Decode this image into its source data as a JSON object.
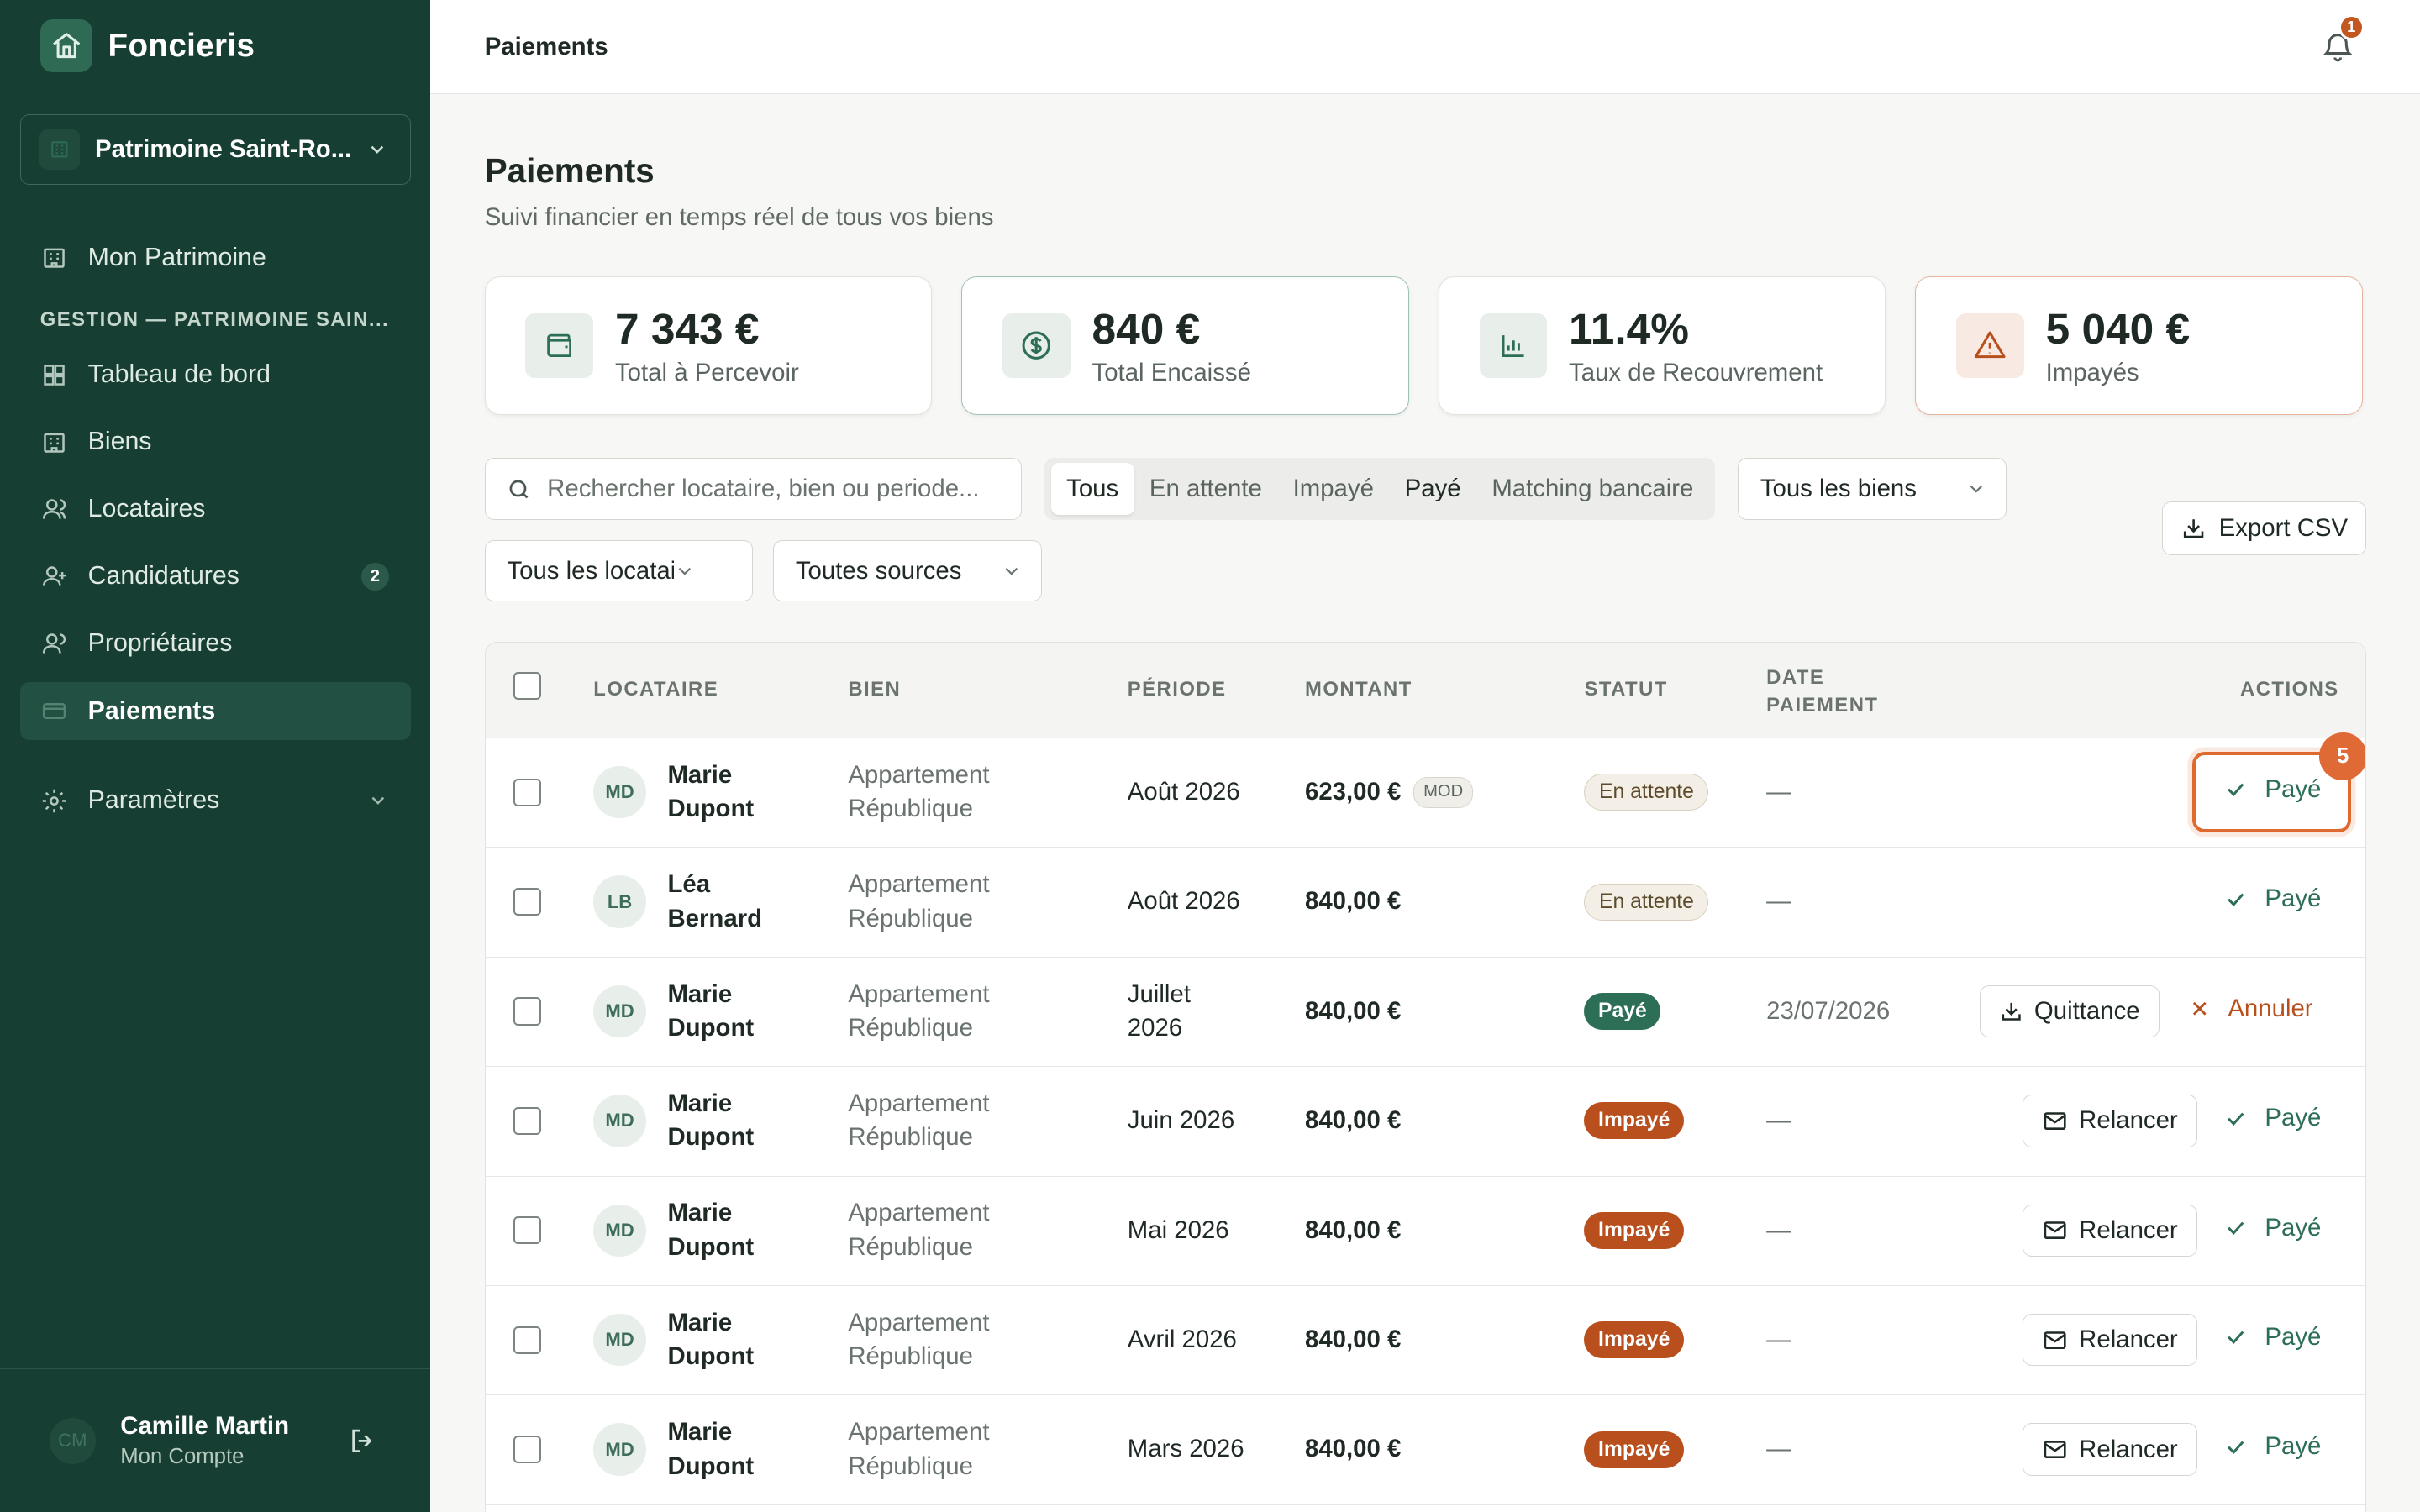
{
  "brand": {
    "name": "Foncieris"
  },
  "workspace": {
    "name": "Patrimoine Saint-Ro..."
  },
  "sidebar": {
    "top_item": "Mon Patrimoine",
    "section_label": "GESTION — PATRIMOINE SAIN...",
    "items": [
      {
        "label": "Tableau de bord",
        "icon": "dashboard-icon"
      },
      {
        "label": "Biens",
        "icon": "building-icon"
      },
      {
        "label": "Locataires",
        "icon": "user-icon"
      },
      {
        "label": "Candidatures",
        "icon": "user-plus-icon",
        "badge": "2"
      },
      {
        "label": "Propriétaires",
        "icon": "user-icon"
      },
      {
        "label": "Paiements",
        "icon": "credit-card-icon",
        "active": true
      }
    ],
    "settings": "Paramètres",
    "user": {
      "initials": "CM",
      "name": "Camille Martin",
      "sub": "Mon Compte"
    }
  },
  "topbar": {
    "title": "Paiements",
    "notifications": "1"
  },
  "page": {
    "title": "Paiements",
    "subtitle": "Suivi financier en temps réel de tous vos biens"
  },
  "stats": [
    {
      "value": "7 343 €",
      "label": "Total à Percevoir",
      "icon": "wallet-icon"
    },
    {
      "value": "840 €",
      "label": "Total Encaissé",
      "icon": "dollar-circle-icon"
    },
    {
      "value": "11.4%",
      "label": "Taux de Recouvrement",
      "icon": "bar-chart-icon"
    },
    {
      "value": "5 040 €",
      "label": "Impayés",
      "icon": "warning-icon"
    }
  ],
  "search": {
    "placeholder": "Rechercher locataire, bien ou periode...",
    "value": ""
  },
  "filters": [
    "Tous",
    "En attente",
    "Impayé",
    "Payé",
    "Matching bancaire"
  ],
  "selects": {
    "biens": "Tous les biens",
    "locataires": "Tous les locataires",
    "sources": "Toutes sources"
  },
  "export_label": "Export CSV",
  "table": {
    "headers": {
      "locataire": "LOCATAIRE",
      "bien": "BIEN",
      "periode": "PÉRIODE",
      "montant": "MONTANT",
      "statut": "STATUT",
      "date1": "DATE",
      "date2": "PAIEMENT",
      "actions": "ACTIONS"
    },
    "rows": [
      {
        "initials": "MD",
        "first": "Marie",
        "last": "Dupont",
        "bien1": "Appartement",
        "bien2": "République",
        "periode1": "Août 2026",
        "periode2": "",
        "montant": "623,00 €",
        "mod": "MOD",
        "statut": "En attente",
        "date": "—",
        "action": "Payé"
      },
      {
        "initials": "LB",
        "first": "Léa",
        "last": "Bernard",
        "bien1": "Appartement",
        "bien2": "République",
        "periode1": "Août 2026",
        "periode2": "",
        "montant": "840,00 €",
        "statut": "En attente",
        "date": "—",
        "action": "Payé"
      },
      {
        "initials": "MD",
        "first": "Marie",
        "last": "Dupont",
        "bien1": "Appartement",
        "bien2": "République",
        "periode1": "Juillet",
        "periode2": "2026",
        "montant": "840,00 €",
        "statut": "Payé",
        "date": "23/07/2026",
        "secondary": "Quittance",
        "action": "Annuler"
      },
      {
        "initials": "MD",
        "first": "Marie",
        "last": "Dupont",
        "bien1": "Appartement",
        "bien2": "République",
        "periode1": "Juin 2026",
        "periode2": "",
        "montant": "840,00 €",
        "statut": "Impayé",
        "date": "—",
        "secondary": "Relancer",
        "action": "Payé"
      },
      {
        "initials": "MD",
        "first": "Marie",
        "last": "Dupont",
        "bien1": "Appartement",
        "bien2": "République",
        "periode1": "Mai 2026",
        "periode2": "",
        "montant": "840,00 €",
        "statut": "Impayé",
        "date": "—",
        "secondary": "Relancer",
        "action": "Payé"
      },
      {
        "initials": "MD",
        "first": "Marie",
        "last": "Dupont",
        "bien1": "Appartement",
        "bien2": "République",
        "periode1": "Avril 2026",
        "periode2": "",
        "montant": "840,00 €",
        "statut": "Impayé",
        "date": "—",
        "secondary": "Relancer",
        "action": "Payé"
      },
      {
        "initials": "MD",
        "first": "Marie",
        "last": "Dupont",
        "bien1": "Appartement",
        "bien2": "République",
        "periode1": "Mars 2026",
        "periode2": "",
        "montant": "840,00 €",
        "statut": "Impayé",
        "date": "—",
        "secondary": "Relancer",
        "action": "Payé"
      }
    ]
  },
  "highlight_badge": "5",
  "colors": {
    "sidebar": "#173e32",
    "accent": "#2d6e57",
    "danger": "#b84f1c",
    "highlight": "#de6a30"
  }
}
